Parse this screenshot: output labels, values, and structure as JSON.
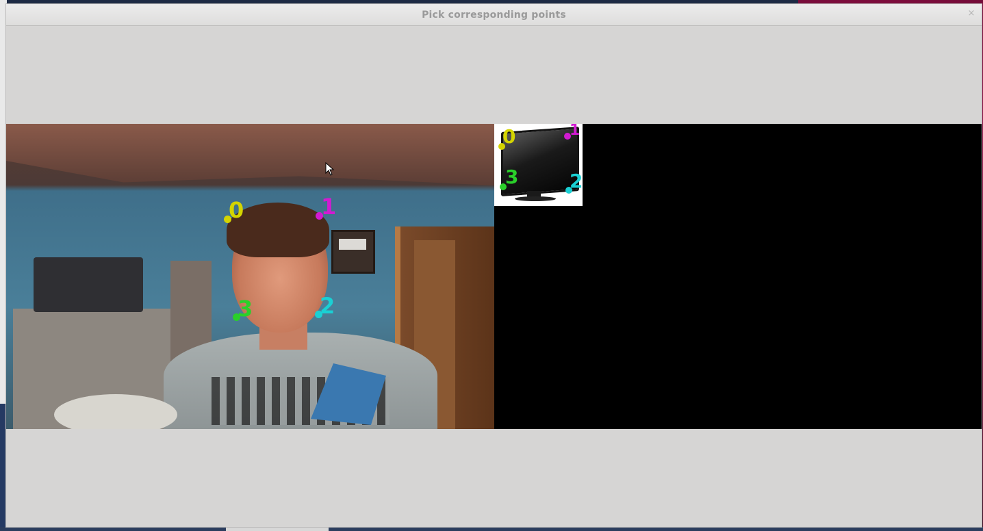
{
  "window": {
    "title": "Pick corresponding points",
    "close_glyph": "×"
  },
  "colors": {
    "point0": "#d4d400",
    "point1": "#d21ad2",
    "point2": "#1ad0d4",
    "point3": "#2ad02a",
    "canvas_bg": "#000000",
    "window_bg": "#d6d5d4"
  },
  "left_points": [
    {
      "label": "0"
    },
    {
      "label": "1"
    },
    {
      "label": "2"
    },
    {
      "label": "3"
    }
  ],
  "right_points": [
    {
      "label": "0"
    },
    {
      "label": "1"
    },
    {
      "label": "2"
    },
    {
      "label": "3"
    }
  ]
}
